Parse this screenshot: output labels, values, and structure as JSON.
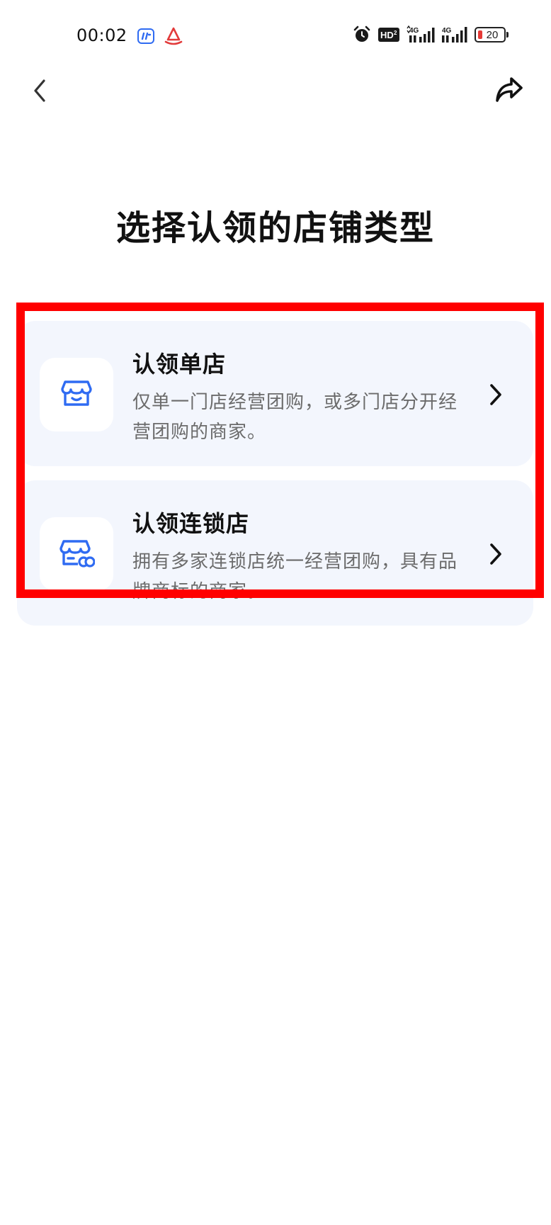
{
  "status_bar": {
    "time": "00:02",
    "battery_level": "20",
    "network_1": "4G",
    "network_2": "4G",
    "hd_label": "HD",
    "icons": [
      "app-icon-blue",
      "app-icon-red-boat",
      "alarm-icon",
      "hd-voice-icon",
      "signal-icon",
      "signal-icon",
      "battery-icon"
    ]
  },
  "nav": {
    "back_icon": "chevron-left-icon",
    "share_icon": "share-icon"
  },
  "page": {
    "title": "选择认领的店铺类型"
  },
  "options": [
    {
      "title": "认领单店",
      "description": "仅单一门店经营团购，或多门店分开经营团购的商家。",
      "icon": "store-icon"
    },
    {
      "title": "认领连锁店",
      "description": "拥有多家连锁店统一经营团购，具有品牌商标的商家。",
      "icon": "chain-store-icon"
    }
  ],
  "colors": {
    "card_background": "#f3f6fd",
    "icon_blue": "#2f6bf2",
    "highlight": "#ff0000",
    "battery_low": "#e53935"
  }
}
